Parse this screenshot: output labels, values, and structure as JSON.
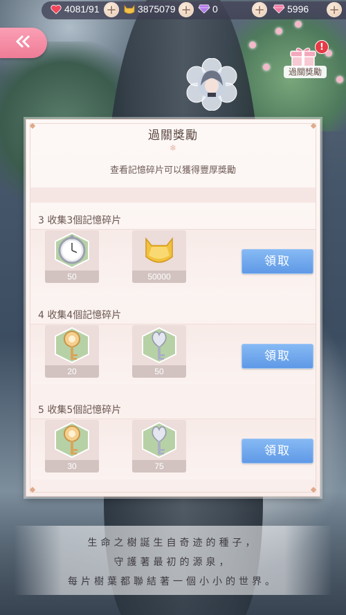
{
  "currency": {
    "stamina": "4081/91",
    "coins": "3875079",
    "gems": "0",
    "diamonds": "5996"
  },
  "colors": {
    "accent_pink": "#ef7c97",
    "claim_blue": "#6fa8ee",
    "panel_bg": "#fdf8f6"
  },
  "reward_shortcut": {
    "label": "過關獎勵",
    "badge": "!"
  },
  "dialog": {
    "title": "過關獎勵",
    "subtitle": "查看記憶碎片可以獲得豐厚獎勵",
    "sections": [
      {
        "title": "3 收集3個記憶碎片",
        "claim_label": "領取",
        "items": [
          {
            "icon": "pocket-watch-icon",
            "qty": "50"
          },
          {
            "icon": "gold-cat-coin-icon",
            "qty": "50000"
          }
        ]
      },
      {
        "title": "4 收集4個記憶碎片",
        "claim_label": "領取",
        "items": [
          {
            "icon": "gold-key-icon",
            "qty": "20"
          },
          {
            "icon": "silver-key-icon",
            "qty": "50"
          }
        ]
      },
      {
        "title": "5 收集5個記憶碎片",
        "claim_label": "領取",
        "items": [
          {
            "icon": "gold-key-icon",
            "qty": "30"
          },
          {
            "icon": "silver-key-icon",
            "qty": "75"
          }
        ]
      }
    ]
  },
  "story": {
    "line1": "生命之樹誕生自奇迹的種子，",
    "line2": "守護著最初的源泉，",
    "line3": "每片樹葉都聯結著一個小小的世界。"
  }
}
